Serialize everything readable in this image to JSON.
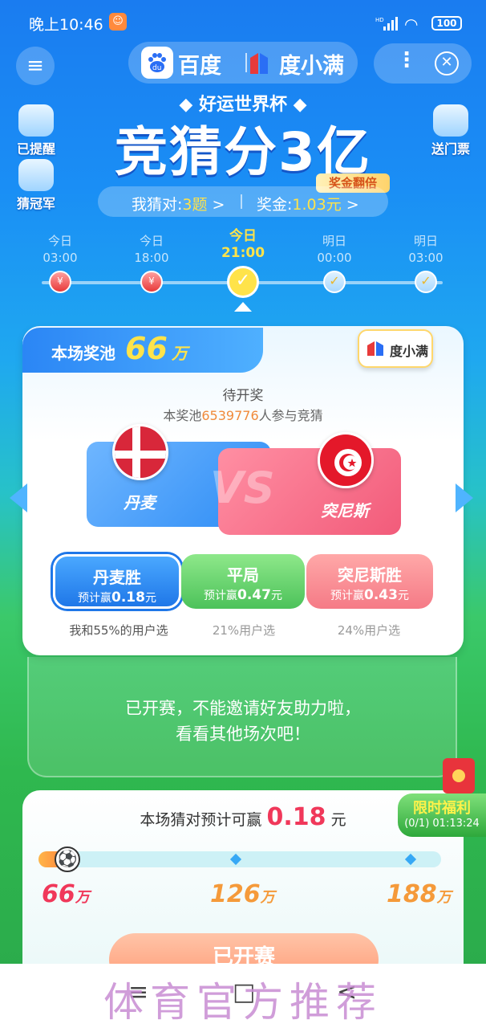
{
  "status_bar": {
    "time": "晚上10:46",
    "battery": "100",
    "signal": "HD"
  },
  "header": {
    "brand_baidu": "百度",
    "brand_dxm": "度小满"
  },
  "hero": {
    "subtitle": "◆ 好运世界杯 ◆",
    "title": "竞猜分3亿",
    "double_badge": "奖金翻倍"
  },
  "side": {
    "reminded": "已提醒",
    "guess_champion": "猜冠军",
    "send_tickets": "送门票"
  },
  "stats": {
    "correct_label": "我猜对:",
    "correct_value": "3题",
    "bonus_label": "奖金:",
    "bonus_value": "1.03元",
    "arrow": ">"
  },
  "timeline": [
    {
      "day": "今日",
      "time": "03:00"
    },
    {
      "day": "今日",
      "time": "18:00"
    },
    {
      "day": "今日",
      "time": "21:00"
    },
    {
      "day": "明日",
      "time": "00:00"
    },
    {
      "day": "明日",
      "time": "03:00"
    }
  ],
  "match": {
    "pool_label": "本场奖池",
    "pool_value": "66",
    "pool_unit": "万",
    "dxm_tag": "度小满",
    "status": "待开奖",
    "participants_prefix": "本奖池",
    "participants_count": "6539776",
    "participants_suffix": "人参与竞猜",
    "team_left": "丹麦",
    "team_right": "突尼斯",
    "vs": "VS",
    "options": [
      {
        "title": "丹麦胜",
        "sub": "预计赢",
        "amount": "0.18",
        "unit": "元",
        "note": "我和55%的用户选"
      },
      {
        "title": "平局",
        "sub": "预计赢",
        "amount": "0.47",
        "unit": "元",
        "note": "21%用户选"
      },
      {
        "title": "突尼斯胜",
        "sub": "预计赢",
        "amount": "0.43",
        "unit": "元",
        "note": "24%用户选"
      }
    ]
  },
  "started_notice": {
    "line1": "已开赛，不能邀请好友助力啦，",
    "line2": "看看其他场次吧！"
  },
  "reward": {
    "prefix": "本场猜对预计可赢",
    "amount": "0.18",
    "unit": "元",
    "progress": 0.08,
    "tiers": [
      {
        "value": "66",
        "unit": "万",
        "color": "#f0385a"
      },
      {
        "value": "126",
        "unit": "万",
        "color": "#f59a3a"
      },
      {
        "value": "188",
        "unit": "万",
        "color": "#f59a3a"
      }
    ],
    "button": "已开赛"
  },
  "limited_offer": {
    "title": "限时福利",
    "detail": "(0/1) 01:13:24"
  },
  "nav": {
    "menu": "≡",
    "home": "□",
    "back": "<"
  },
  "watermark": "体育官方推荐"
}
